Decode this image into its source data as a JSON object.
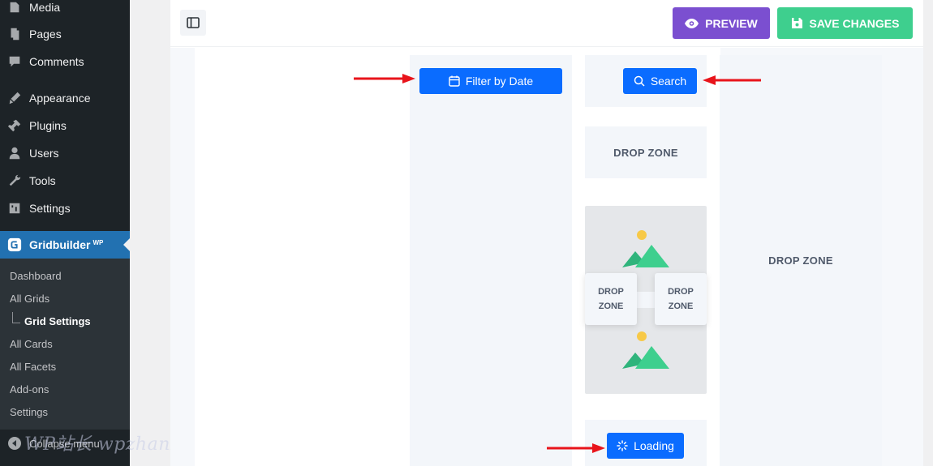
{
  "wp_menu": {
    "items": [
      {
        "label": "Media",
        "icon": "media-icon"
      },
      {
        "label": "Pages",
        "icon": "pages-icon"
      },
      {
        "label": "Comments",
        "icon": "comments-icon"
      },
      {
        "label": "Appearance",
        "icon": "appearance-icon"
      },
      {
        "label": "Plugins",
        "icon": "plugins-icon"
      },
      {
        "label": "Users",
        "icon": "users-icon"
      },
      {
        "label": "Tools",
        "icon": "tools-icon"
      },
      {
        "label": "Settings",
        "icon": "settings-icon"
      }
    ],
    "active": {
      "label": "Gridbuilder",
      "sup": "WP",
      "icon": "gridbuilder-icon"
    },
    "submenu": [
      "Dashboard",
      "All Grids",
      "Grid Settings",
      "All Cards",
      "All Facets",
      "Add-ons",
      "Settings"
    ],
    "current_submenu": "Grid Settings",
    "collapse_label": "Collapse menu"
  },
  "watermark": "WP站长 wpzhanzhang.eastfu.com",
  "toolbar": {
    "preview_label": "PREVIEW",
    "save_label": "SAVE CHANGES"
  },
  "builder": {
    "filter_button": "Filter by Date",
    "search_button": "Search",
    "drop_zone": "DROP ZONE",
    "card_zone_line1": "DROP",
    "card_zone_line2": "ZONE",
    "loading_button": "Loading"
  },
  "colors": {
    "wp_sidebar": "#1d2327",
    "wp_active": "#2271b1",
    "preview": "#7b4fd0",
    "save": "#3ecf8e",
    "facet_blue": "#0a6cff",
    "arrow_red": "#e8141b"
  }
}
